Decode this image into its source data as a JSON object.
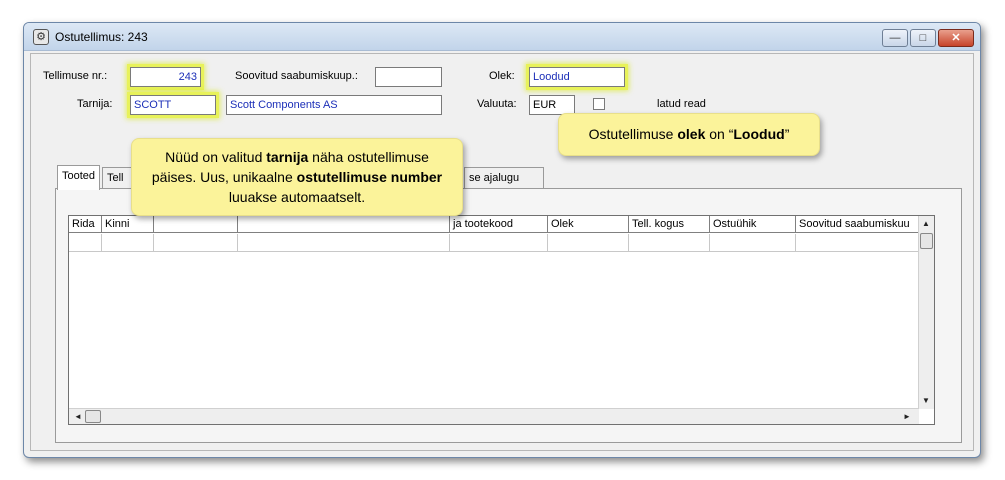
{
  "window": {
    "title": "Ostutellimus: 243",
    "icon": "gear-app-icon",
    "controls": {
      "minimize": "—",
      "maximize": "□",
      "close": "✕"
    }
  },
  "header": {
    "order_no_label": "Tellimuse nr.:",
    "order_no_value": "243",
    "desired_arrival_label": "Soovitud saabumiskuup.:",
    "desired_arrival_value": "",
    "status_label": "Olek:",
    "status_value": "Loodud",
    "supplier_label": "Tarnija:",
    "supplier_code": "SCOTT",
    "supplier_name": "Scott Components AS",
    "currency_label": "Valuuta:",
    "currency_value": "EUR",
    "checkbox_label_tail": "latud read"
  },
  "tabs": [
    {
      "label": "Tooted"
    },
    {
      "label": "Tell"
    },
    {
      "label": "se ajalugu"
    }
  ],
  "grid": {
    "columns": [
      "Rida",
      "Kinni",
      "",
      "",
      "ja tootekood",
      "Olek",
      "Tell. kogus",
      "Ostuühik",
      "Soovitud saabumiskuu"
    ],
    "scroll_up": "▲",
    "scroll_down": "▼",
    "scroll_left": "◄",
    "scroll_right": "►"
  },
  "callouts": {
    "left": {
      "p1": "Nüüd on valitud ",
      "b1": "tarnija",
      "p2": " näha ostutellimuse päises.  Uus, unikaalne ",
      "b2": "ostutellimuse number",
      "p3": " luuakse automaatselt."
    },
    "right": {
      "p1": "Ostutellimuse ",
      "b1": "olek",
      "p2": " on “",
      "b2": "Loodud",
      "p3": "”"
    }
  },
  "colors": {
    "highlight": "#e8f25a",
    "callout_bg": "#fbf39a",
    "link_blue": "#1c2fb8"
  }
}
